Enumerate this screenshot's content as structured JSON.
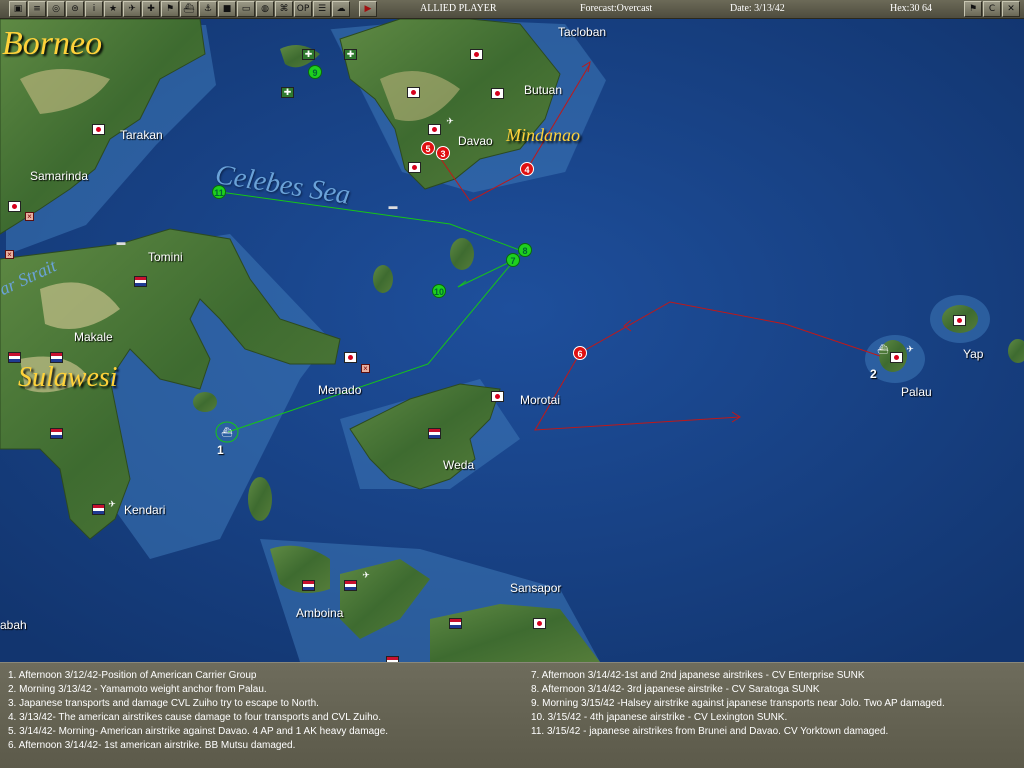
{
  "toolbar": {
    "buttons_left": [
      {
        "name": "menu-icon",
        "glyph": "▣"
      },
      {
        "name": "report-icon",
        "glyph": "≡"
      },
      {
        "name": "air-icon",
        "glyph": "◎"
      },
      {
        "name": "naval-icon",
        "glyph": "⊜"
      },
      {
        "name": "info-icon",
        "glyph": "i"
      },
      {
        "name": "star-icon",
        "glyph": "★"
      },
      {
        "name": "plane-icon",
        "glyph": "✈"
      },
      {
        "name": "ground-icon",
        "glyph": "✚"
      },
      {
        "name": "flag-icon",
        "glyph": "⚑"
      },
      {
        "name": "ship-icon",
        "glyph": "⛴"
      },
      {
        "name": "sub-icon",
        "glyph": "⚓"
      },
      {
        "name": "color-icon",
        "glyph": "■"
      },
      {
        "name": "convoy-icon",
        "glyph": "▭"
      },
      {
        "name": "globe-icon",
        "glyph": "◍"
      },
      {
        "name": "network-icon",
        "glyph": "⌘"
      },
      {
        "name": "op-icon",
        "glyph": "OP"
      },
      {
        "name": "list-icon",
        "glyph": "☰"
      },
      {
        "name": "cloud-icon",
        "glyph": "☁"
      }
    ],
    "play": {
      "name": "play-icon",
      "glyph": "▶"
    },
    "player": "ALLIED PLAYER",
    "forecast": "Forecast:Overcast",
    "date": "Date: 3/13/42",
    "hex": "Hex:30 64",
    "buttons_right": [
      {
        "name": "flag-toggle-icon",
        "glyph": "⚑"
      },
      {
        "name": "c-icon",
        "glyph": "C"
      },
      {
        "name": "close-icon",
        "glyph": "✕"
      }
    ]
  },
  "map": {
    "regions": {
      "borneo": "Borneo",
      "mindanao": "Mindanao",
      "sulawesi": "Sulawesi"
    },
    "seas": {
      "celebes": "Celebes Sea",
      "strait": "ar Strait"
    },
    "places": {
      "tacloban": "Tacloban",
      "butuan": "Butuan",
      "davao": "Davao",
      "tarakan": "Tarakan",
      "samarinda": "Samarinda",
      "tomini": "Tomini",
      "makale": "Makale",
      "menado": "Menado",
      "morotai": "Morotai",
      "weda": "Weda",
      "kendari": "Kendari",
      "amboina": "Amboina",
      "sansapor": "Sansapor",
      "palau": "Palau",
      "yap": "Yap",
      "abah": "abah"
    },
    "numbers": {
      "one": "1",
      "two": "2"
    },
    "markers": {
      "m3": "3",
      "m4": "4",
      "m5": "5",
      "m6": "6",
      "m7": "7",
      "m8": "8",
      "m9": "9",
      "m10": "10",
      "m11": "11"
    },
    "colors": {
      "sea": "#163f86",
      "land": "#4f7a3a",
      "japanese_route": "#c01818",
      "american_route": "#16c616"
    }
  },
  "log": {
    "left": [
      "1. Afternoon 3/12/42-Position of American Carrier Group",
      "2. Morning 3/13/42 - Yamamoto weight anchor from Palau.",
      "3. Japanese transports and damage CVL Zuiho try to escape to North.",
      "4. 3/13/42- The american airstrikes cause damage to four transports and CVL Zuiho.",
      "5. 3/14/42- Morning- American airstrike against Davao. 4 AP and 1 AK heavy damage.",
      "6. Afternoon 3/14/42- 1st american airstrike. BB Mutsu damaged."
    ],
    "right": [
      "7. Afternoon 3/14/42-1st and 2nd japanese airstrikes - CV Enterprise SUNK",
      "8. Afternoon 3/14/42- 3rd japanese airstrike - CV Saratoga SUNK",
      "9. Morning 3/15/42 -Halsey airstrike against japanese transports near Jolo. Two AP damaged.",
      "10. 3/15/42 - 4th japanese airstrike - CV Lexington SUNK.",
      "11. 3/15/42 - japanese airstrikes from Brunei and Davao. CV Yorktown damaged."
    ]
  }
}
